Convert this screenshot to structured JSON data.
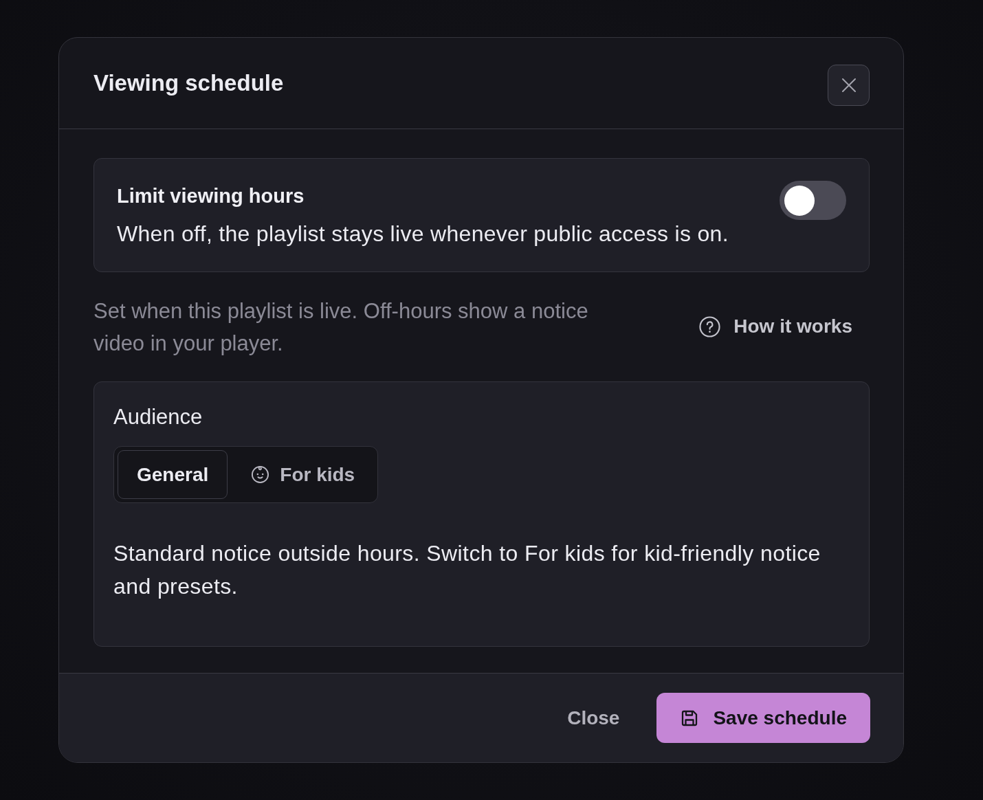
{
  "dialog": {
    "title": "Viewing schedule"
  },
  "limit_card": {
    "title": "Limit viewing hours",
    "description": "When off, the playlist stays live whenever public access is on.",
    "toggle": {
      "on": false
    }
  },
  "help": {
    "text": "Set when this playlist is live. Off-hours show a notice video in your player.",
    "link": "How it works"
  },
  "audience": {
    "label": "Audience",
    "options": [
      {
        "label": "General",
        "kind": "plain",
        "selected": true
      },
      {
        "label": "For kids",
        "kind": "kids",
        "selected": false
      }
    ],
    "description": "Standard notice outside hours. Switch to For kids for kid-friendly notice and presets."
  },
  "footer": {
    "buttons": [
      {
        "label": "Close",
        "kind": "ghost"
      },
      {
        "label": "Save schedule",
        "kind": "primary"
      }
    ]
  }
}
